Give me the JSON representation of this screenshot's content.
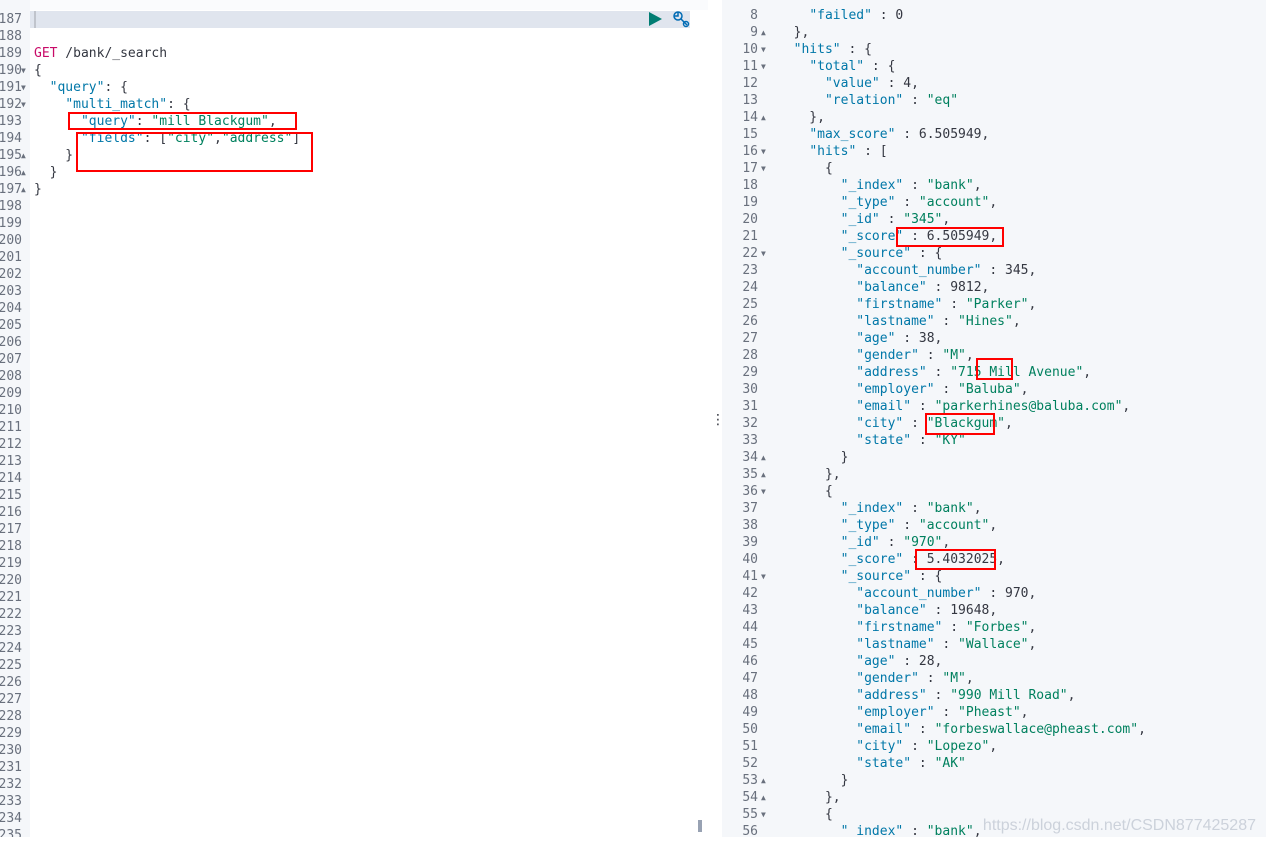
{
  "colors": {
    "key": "#0077a8",
    "string": "#00805e",
    "method": "#c80a68",
    "highlight": "#ff0000",
    "run": "#017d73",
    "wrench": "#006bb4"
  },
  "toolbar": {
    "run_icon": "play-icon",
    "settings_icon": "wrench-icon"
  },
  "request": {
    "lines": [
      {
        "n": "187",
        "t": "",
        "active": true
      },
      {
        "n": "188",
        "t": ""
      },
      {
        "n": "189",
        "t": "GET /bank/_search"
      },
      {
        "n": "190",
        "t": "{",
        "fold": "down"
      },
      {
        "n": "191",
        "t": "  \"query\": {",
        "fold": "down"
      },
      {
        "n": "192",
        "t": "    \"multi_match\": {",
        "fold": "down"
      },
      {
        "n": "193",
        "t": "      \"query\": \"mill Blackgum\","
      },
      {
        "n": "194",
        "t": "      \"fields\": [\"city\",\"address\"]"
      },
      {
        "n": "195",
        "t": "    }",
        "fold": "up"
      },
      {
        "n": "196",
        "t": "  }",
        "fold": "up"
      },
      {
        "n": "197",
        "t": "}",
        "fold": "up"
      },
      {
        "n": "198",
        "t": ""
      },
      {
        "n": "199",
        "t": ""
      },
      {
        "n": "200",
        "t": ""
      },
      {
        "n": "201",
        "t": ""
      },
      {
        "n": "202",
        "t": ""
      },
      {
        "n": "203",
        "t": ""
      },
      {
        "n": "204",
        "t": ""
      },
      {
        "n": "205",
        "t": ""
      },
      {
        "n": "206",
        "t": ""
      },
      {
        "n": "207",
        "t": ""
      },
      {
        "n": "208",
        "t": ""
      },
      {
        "n": "209",
        "t": ""
      },
      {
        "n": "210",
        "t": ""
      },
      {
        "n": "211",
        "t": ""
      },
      {
        "n": "212",
        "t": ""
      },
      {
        "n": "213",
        "t": ""
      },
      {
        "n": "214",
        "t": ""
      },
      {
        "n": "215",
        "t": ""
      },
      {
        "n": "216",
        "t": ""
      },
      {
        "n": "217",
        "t": ""
      },
      {
        "n": "218",
        "t": ""
      },
      {
        "n": "219",
        "t": ""
      },
      {
        "n": "220",
        "t": ""
      },
      {
        "n": "221",
        "t": ""
      },
      {
        "n": "222",
        "t": ""
      },
      {
        "n": "223",
        "t": ""
      },
      {
        "n": "224",
        "t": ""
      },
      {
        "n": "225",
        "t": ""
      },
      {
        "n": "226",
        "t": ""
      },
      {
        "n": "227",
        "t": ""
      },
      {
        "n": "228",
        "t": ""
      },
      {
        "n": "229",
        "t": ""
      },
      {
        "n": "230",
        "t": ""
      },
      {
        "n": "231",
        "t": ""
      },
      {
        "n": "232",
        "t": ""
      },
      {
        "n": "233",
        "t": ""
      },
      {
        "n": "234",
        "t": ""
      },
      {
        "n": "235",
        "t": ""
      }
    ]
  },
  "response": {
    "lines": [
      {
        "n": "8",
        "t": "    \"failed\" : 0"
      },
      {
        "n": "9",
        "t": "  },",
        "fold": "up"
      },
      {
        "n": "10",
        "t": "  \"hits\" : {",
        "fold": "down"
      },
      {
        "n": "11",
        "t": "    \"total\" : {",
        "fold": "down"
      },
      {
        "n": "12",
        "t": "      \"value\" : 4,"
      },
      {
        "n": "13",
        "t": "      \"relation\" : \"eq\""
      },
      {
        "n": "14",
        "t": "    },",
        "fold": "up"
      },
      {
        "n": "15",
        "t": "    \"max_score\" : 6.505949,"
      },
      {
        "n": "16",
        "t": "    \"hits\" : [",
        "fold": "down"
      },
      {
        "n": "17",
        "t": "      {",
        "fold": "down"
      },
      {
        "n": "18",
        "t": "        \"_index\" : \"bank\","
      },
      {
        "n": "19",
        "t": "        \"_type\" : \"account\","
      },
      {
        "n": "20",
        "t": "        \"_id\" : \"345\","
      },
      {
        "n": "21",
        "t": "        \"_score\" : 6.505949,"
      },
      {
        "n": "22",
        "t": "        \"_source\" : {",
        "fold": "down"
      },
      {
        "n": "23",
        "t": "          \"account_number\" : 345,"
      },
      {
        "n": "24",
        "t": "          \"balance\" : 9812,"
      },
      {
        "n": "25",
        "t": "          \"firstname\" : \"Parker\","
      },
      {
        "n": "26",
        "t": "          \"lastname\" : \"Hines\","
      },
      {
        "n": "27",
        "t": "          \"age\" : 38,"
      },
      {
        "n": "28",
        "t": "          \"gender\" : \"M\","
      },
      {
        "n": "29",
        "t": "          \"address\" : \"715 Mill Avenue\","
      },
      {
        "n": "30",
        "t": "          \"employer\" : \"Baluba\","
      },
      {
        "n": "31",
        "t": "          \"email\" : \"parkerhines@baluba.com\","
      },
      {
        "n": "32",
        "t": "          \"city\" : \"Blackgum\","
      },
      {
        "n": "33",
        "t": "          \"state\" : \"KY\""
      },
      {
        "n": "34",
        "t": "        }",
        "fold": "up"
      },
      {
        "n": "35",
        "t": "      },",
        "fold": "up"
      },
      {
        "n": "36",
        "t": "      {",
        "fold": "down"
      },
      {
        "n": "37",
        "t": "        \"_index\" : \"bank\","
      },
      {
        "n": "38",
        "t": "        \"_type\" : \"account\","
      },
      {
        "n": "39",
        "t": "        \"_id\" : \"970\","
      },
      {
        "n": "40",
        "t": "        \"_score\" : 5.4032025,"
      },
      {
        "n": "41",
        "t": "        \"_source\" : {",
        "fold": "down"
      },
      {
        "n": "42",
        "t": "          \"account_number\" : 970,"
      },
      {
        "n": "43",
        "t": "          \"balance\" : 19648,"
      },
      {
        "n": "44",
        "t": "          \"firstname\" : \"Forbes\","
      },
      {
        "n": "45",
        "t": "          \"lastname\" : \"Wallace\","
      },
      {
        "n": "46",
        "t": "          \"age\" : 28,"
      },
      {
        "n": "47",
        "t": "          \"gender\" : \"M\","
      },
      {
        "n": "48",
        "t": "          \"address\" : \"990 Mill Road\","
      },
      {
        "n": "49",
        "t": "          \"employer\" : \"Pheast\","
      },
      {
        "n": "50",
        "t": "          \"email\" : \"forbeswallace@pheast.com\","
      },
      {
        "n": "51",
        "t": "          \"city\" : \"Lopezo\","
      },
      {
        "n": "52",
        "t": "          \"state\" : \"AK\""
      },
      {
        "n": "53",
        "t": "        }",
        "fold": "up"
      },
      {
        "n": "54",
        "t": "      },",
        "fold": "up"
      },
      {
        "n": "55",
        "t": "      {",
        "fold": "down"
      },
      {
        "n": "56",
        "t": "        \"_index\" : \"bank\","
      }
    ]
  },
  "watermark": "https://blog.csdn.net/CSDN877425287"
}
